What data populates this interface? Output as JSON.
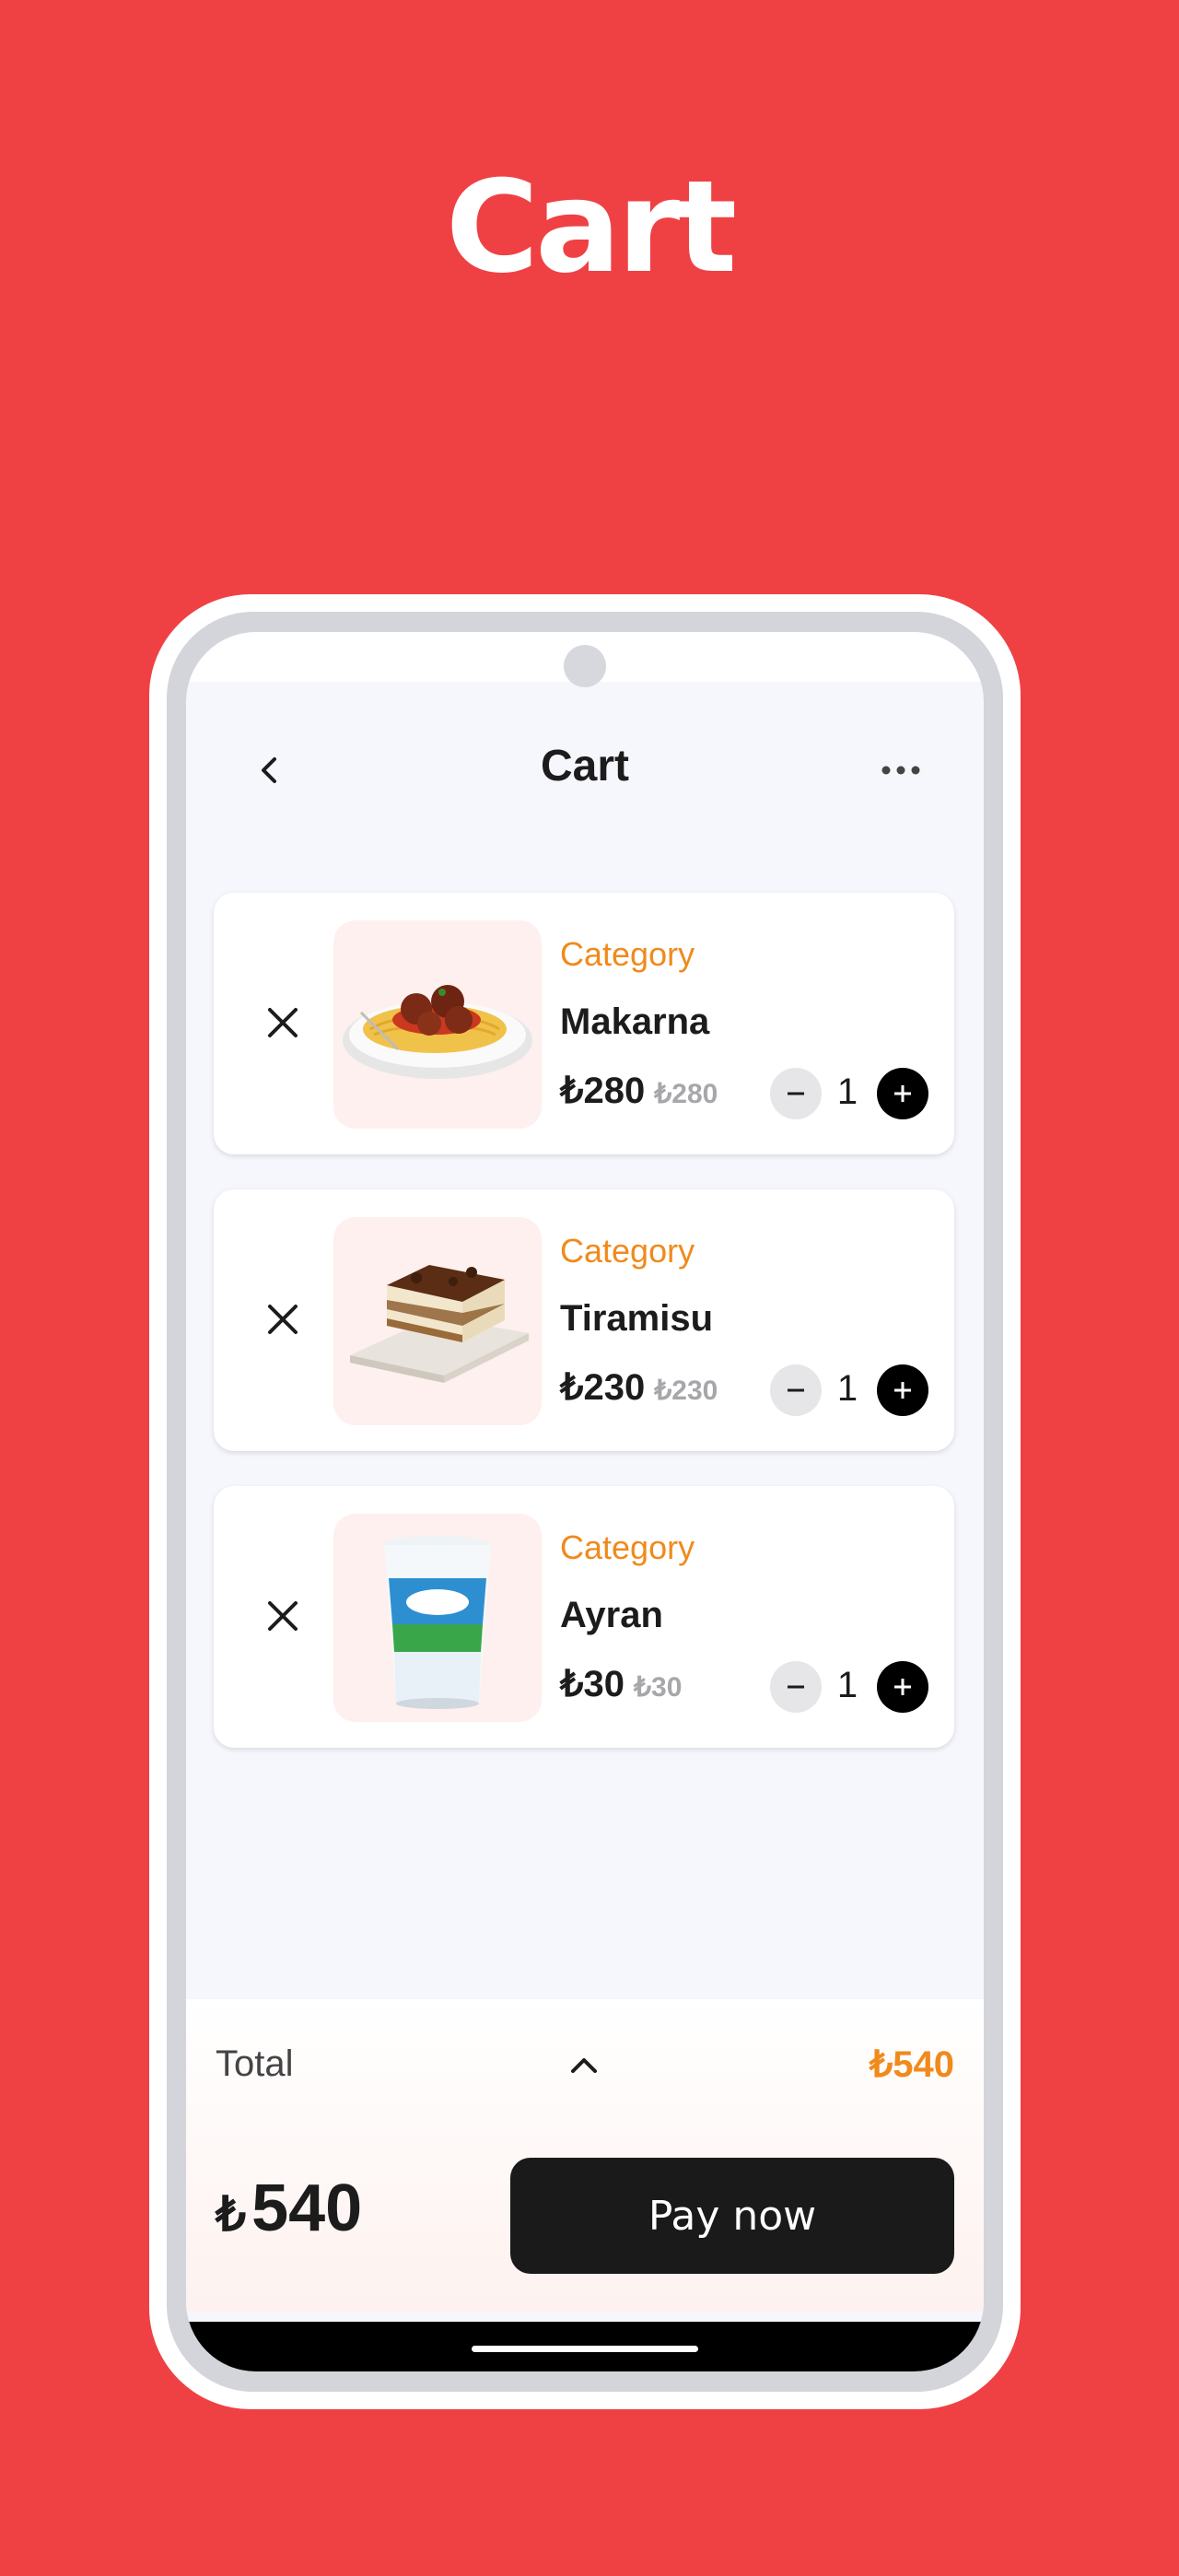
{
  "headline": "Cart",
  "app_bar": {
    "title": "Cart",
    "back_icon": "chevron-left-icon",
    "more_icon": "more-horizontal-icon"
  },
  "cart_items": [
    {
      "category": "Category",
      "name": "Makarna",
      "price": "₺280",
      "old_price": "₺280",
      "quantity": "1",
      "image": "spaghetti-meatballs"
    },
    {
      "category": "Category",
      "name": "Tiramisu",
      "price": "₺230",
      "old_price": "₺230",
      "quantity": "1",
      "image": "tiramisu"
    },
    {
      "category": "Category",
      "name": "Ayran",
      "price": "₺30",
      "old_price": "₺30",
      "quantity": "1",
      "image": "ayran-cup"
    }
  ],
  "summary": {
    "total_label": "Total",
    "total_value": "₺540",
    "grand_currency": "₺",
    "grand_amount": "540",
    "pay_label": "Pay now"
  },
  "colors": {
    "background": "#ef4144",
    "accent_orange": "#f08a1c",
    "dark": "#1a1a1a"
  }
}
